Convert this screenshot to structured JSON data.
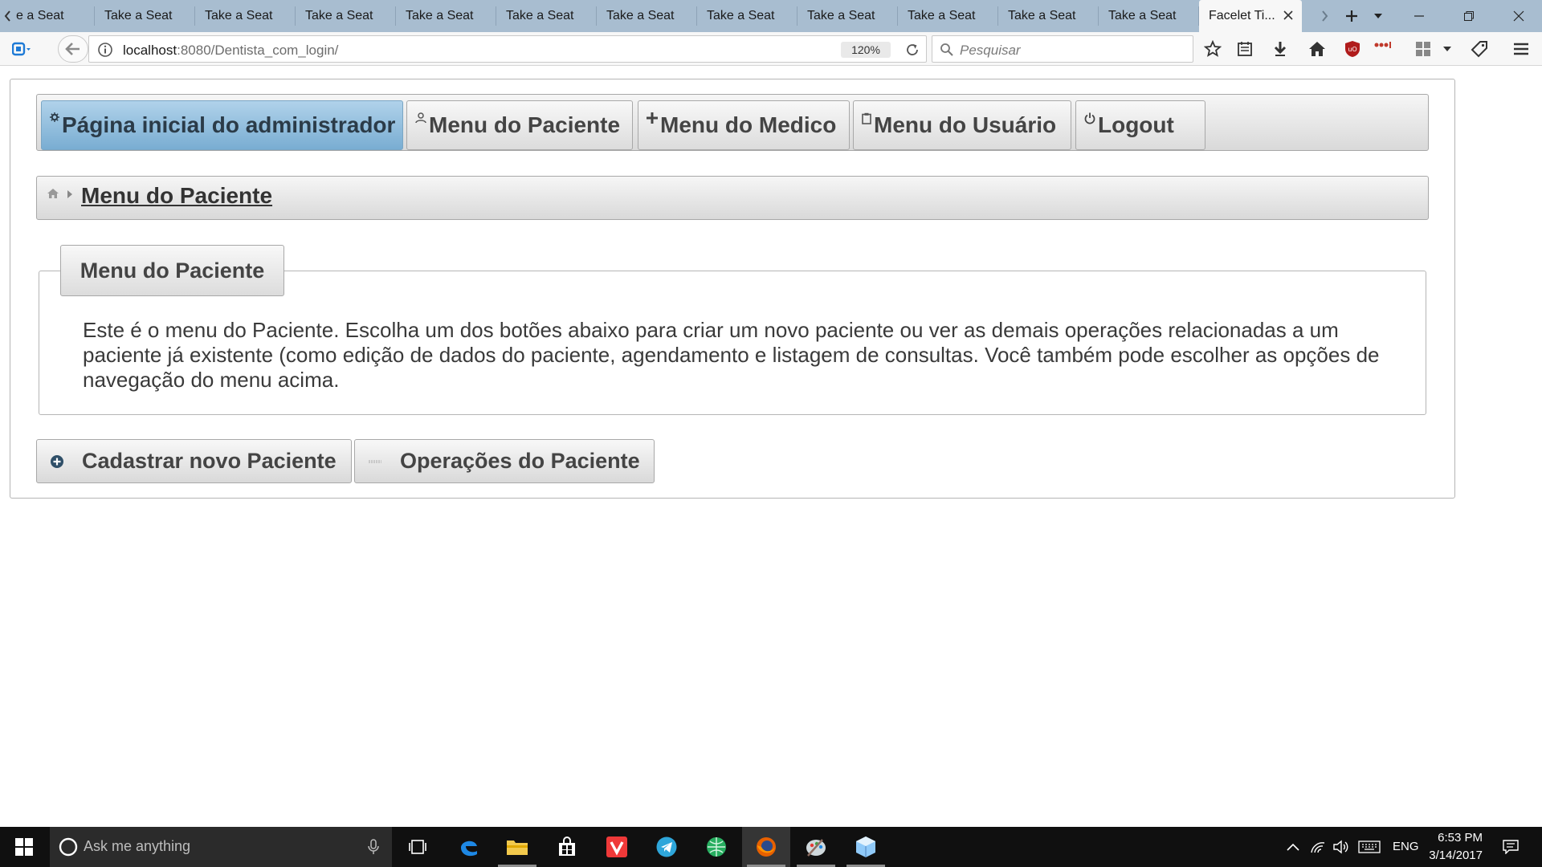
{
  "browser": {
    "tabs": [
      "Take a Seat",
      "Take a Seat",
      "Take a Seat",
      "Take a Seat",
      "Take a Seat",
      "Take a Seat",
      "Take a Seat",
      "Take a Seat",
      "Take a Seat",
      "Take a Seat",
      "Take a Seat",
      "Take a Seat"
    ],
    "first_tab_partial": "e a Seat",
    "active_tab": "Facelet Ti...",
    "url_host": "localhost",
    "url_path": ":8080/Dentista_com_login/",
    "zoom": "120%",
    "search_placeholder": "Pesquisar"
  },
  "menu": {
    "items": [
      {
        "label": "Página inicial do administrador",
        "icon": "gear-icon",
        "active": true
      },
      {
        "label": "Menu do Paciente",
        "icon": "person-icon",
        "active": false
      },
      {
        "label": "Menu do Medico",
        "icon": "plus-icon",
        "active": false
      },
      {
        "label": "Menu do Usuário",
        "icon": "clipboard-icon",
        "active": false
      },
      {
        "label": "Logout",
        "icon": "power-icon",
        "active": false
      }
    ]
  },
  "breadcrumb": {
    "current": "Menu do Paciente"
  },
  "panel": {
    "legend": "Menu do Paciente",
    "description": "Este é o menu do Paciente. Escolha um dos botões abaixo para criar um novo paciente ou ver as demais operações relacionadas a um paciente já existente (como edição de dados do paciente, agendamento e listagem de consultas. Você também pode escolher as opções de navegação do menu acima."
  },
  "actions": {
    "new_patient": "Cadastrar novo Paciente",
    "patient_ops": "Operações do Paciente"
  },
  "taskbar": {
    "search_placeholder": "Ask me anything",
    "language": "ENG",
    "time": "6:53 PM",
    "date": "3/14/2017"
  },
  "colors": {
    "tabstrip": "#a8bdd0",
    "menu_active": "#8ebcdc",
    "taskbar": "#101010"
  }
}
